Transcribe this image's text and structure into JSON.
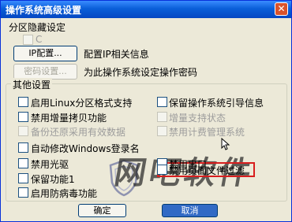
{
  "window": {
    "title": "操作系统高级设置",
    "close_label": "✕"
  },
  "partition": {
    "section_label": "分区隐藏设定",
    "checkbox_label": "C",
    "ip_button": "IP配置...",
    "ip_desc": "配置IP相关信息",
    "pwd_button": "密码设置...",
    "pwd_desc": "为此操作系统设定操作密码"
  },
  "other": {
    "group_label": "其他设置",
    "left": [
      {
        "label": "启用Linux分区格式支持",
        "enabled": true,
        "checked": false
      },
      {
        "label": "禁用增量拷贝功能",
        "enabled": true,
        "checked": false
      },
      {
        "label": "备份还原采用有效数据",
        "enabled": false,
        "checked": false
      },
      {
        "label": "自动修改Windows登录名",
        "enabled": true,
        "checked": false
      },
      {
        "label": "禁用光驱",
        "enabled": true,
        "checked": false
      },
      {
        "label": "保留功能1",
        "enabled": true,
        "checked": false
      },
      {
        "label": "启用防病毒功能",
        "enabled": true,
        "checked": false
      }
    ],
    "right": [
      {
        "label": "保留操作系统引导信息",
        "enabled": true,
        "checked": false
      },
      {
        "label": "增量支持状态",
        "enabled": false,
        "checked": false
      },
      {
        "label": "禁用计费管理系统",
        "enabled": false,
        "checked": false
      },
      {
        "label": "禁用串口",
        "enabled": true,
        "checked": false
      },
      {
        "label": "禁用页面文件过滤",
        "enabled": true,
        "checked": false
      }
    ]
  },
  "watermark": "网吧软件",
  "footer": {
    "ok": "确定",
    "cancel": "取消"
  },
  "colors": {
    "highlight": "#d81e1e",
    "title_bar": "#0a5fd9"
  }
}
